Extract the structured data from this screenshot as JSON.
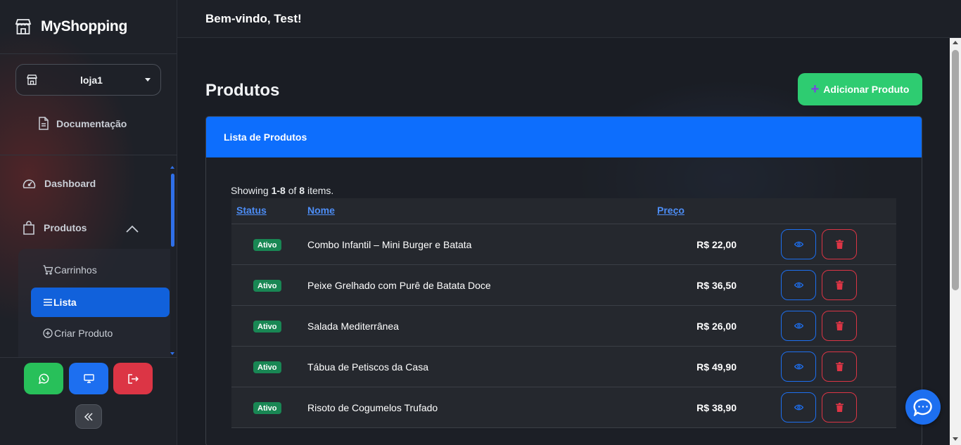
{
  "brand": {
    "name": "MyShopping"
  },
  "store": {
    "selected": "loja1"
  },
  "sidebar": {
    "doc_label": "Documentação",
    "nav": {
      "dashboard": "Dashboard",
      "produtos": "Produtos"
    },
    "submenu": {
      "carrinhos": "Carrinhos",
      "lista": "Lista",
      "criar": "Criar Produto"
    }
  },
  "topbar": {
    "welcome": "Bem-vindo, Test!"
  },
  "page": {
    "title": "Produtos",
    "add_button": "Adicionar Produto",
    "card_title": "Lista de Produtos",
    "summary": {
      "prefix": "Showing ",
      "range": "1-8",
      "middle": " of ",
      "total": "8",
      "suffix": " items."
    }
  },
  "table": {
    "headers": {
      "status": "Status",
      "name": "Nome",
      "price": "Preço"
    },
    "rows": [
      {
        "status": "Ativo",
        "name": "Combo Infantil – Mini Burger e Batata",
        "price": "R$ 22,00"
      },
      {
        "status": "Ativo",
        "name": "Peixe Grelhado com Purê de Batata Doce",
        "price": "R$ 36,50"
      },
      {
        "status": "Ativo",
        "name": "Salada Mediterrânea",
        "price": "R$ 26,00"
      },
      {
        "status": "Ativo",
        "name": "Tábua de Petiscos da Casa",
        "price": "R$ 49,90"
      },
      {
        "status": "Ativo",
        "name": "Risoto de Cogumelos Trufado",
        "price": "R$ 38,90"
      }
    ]
  },
  "colors": {
    "primary": "#0d6efd",
    "success": "#2ecc71",
    "danger": "#dc3545",
    "badge": "#198754",
    "sidebar_active": "#1161db"
  },
  "icons": {
    "brand": "store-icon",
    "store": "store-icon",
    "doc": "document-icon",
    "dashboard": "speedometer-icon",
    "produtos": "shopping-bag-icon",
    "carrinhos": "cart-icon",
    "lista": "list-icon",
    "criar": "plus-circle-icon",
    "view": "eye-icon",
    "delete": "trash-icon",
    "whatsapp": "whatsapp-icon",
    "desktop": "monitor-icon",
    "logout": "logout-icon",
    "collapse": "double-chevron-left-icon",
    "chat": "chat-bubble-icon"
  }
}
